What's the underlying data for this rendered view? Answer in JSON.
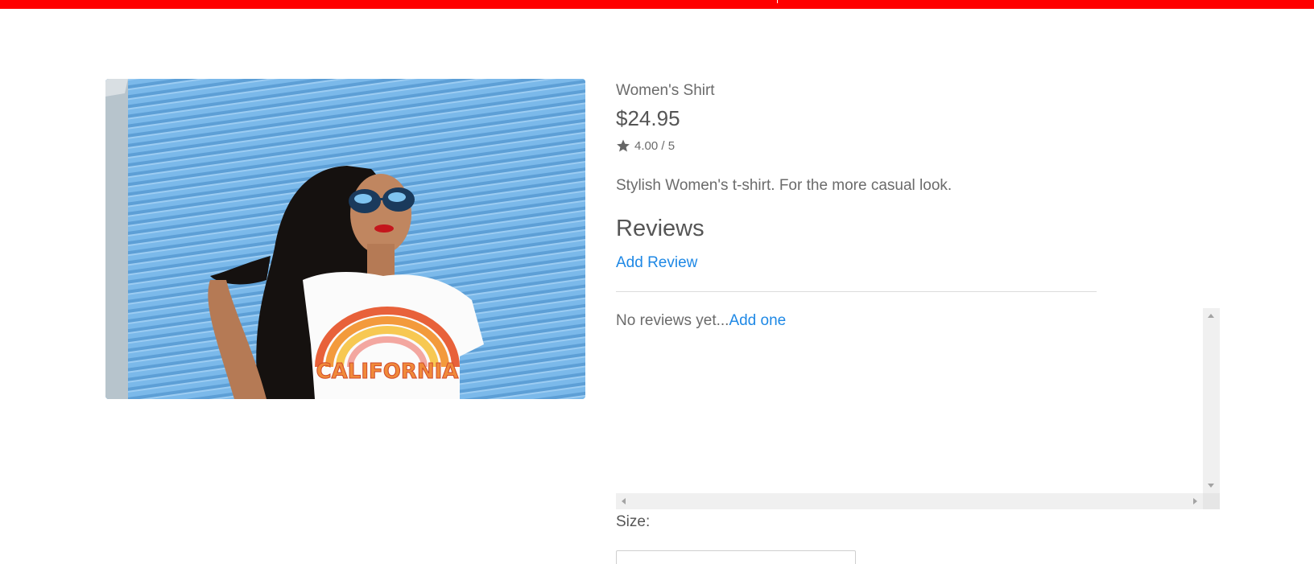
{
  "colors": {
    "top_bar": "#ff0000",
    "link": "#1e88e5",
    "text": "#555555"
  },
  "product": {
    "image_icon": "product-photo",
    "shirt_print": "CALIFORNIA",
    "category": "Women's Shirt",
    "price": "$24.95",
    "rating_icon": "star-icon",
    "rating": "4.00 / 5",
    "description": "Stylish Women's t-shirt. For the more casual look."
  },
  "reviews": {
    "heading": "Reviews",
    "add_review_label": "Add Review",
    "empty_text": "No reviews yet...",
    "add_one_label": "Add one"
  },
  "options": {
    "size_label": "Size:"
  }
}
